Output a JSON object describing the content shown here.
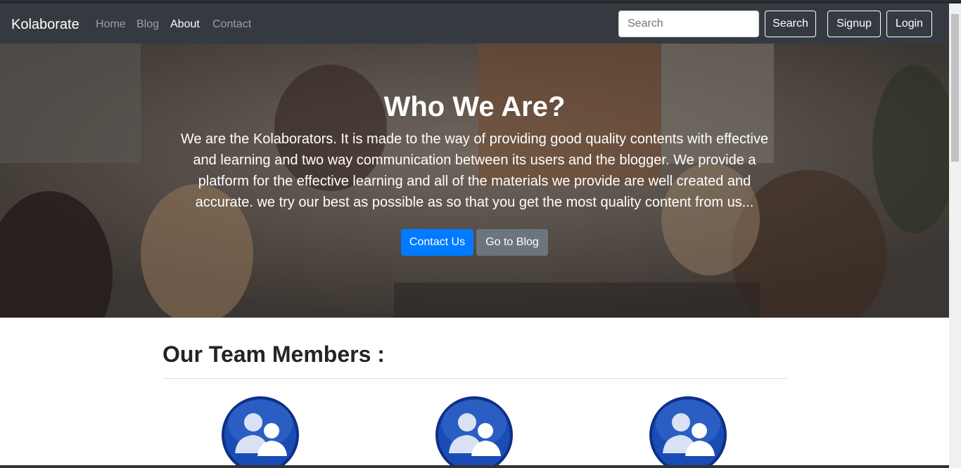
{
  "navbar": {
    "brand": "Kolaborate",
    "links": [
      {
        "label": "Home",
        "active": false
      },
      {
        "label": "Blog",
        "active": false
      },
      {
        "label": "About",
        "active": true
      },
      {
        "label": "Contact",
        "active": false
      }
    ],
    "search_placeholder": "Search",
    "search_button": "Search",
    "signup_button": "Signup",
    "login_button": "Login"
  },
  "hero": {
    "title": "Who We Are?",
    "text": "We are the Kolaborators. It is made to the way of providing good quality contents with effective and learning and two way communication between its users and the blogger. We provide a platform for the effective learning and all of the materials we provide are well created and accurate. we try our best as possible as so that you get the most quality content from us...",
    "contact_button": "Contact Us",
    "blog_button": "Go to Blog"
  },
  "team": {
    "title": "Our Team Members :",
    "members": [
      {
        "icon": "team-avatar-icon"
      },
      {
        "icon": "team-avatar-icon"
      },
      {
        "icon": "team-avatar-icon"
      }
    ]
  },
  "colors": {
    "navbar_bg": "#343a40",
    "primary": "#007bff",
    "secondary": "#6c757d",
    "avatar_blue": "#1a3d9c"
  }
}
